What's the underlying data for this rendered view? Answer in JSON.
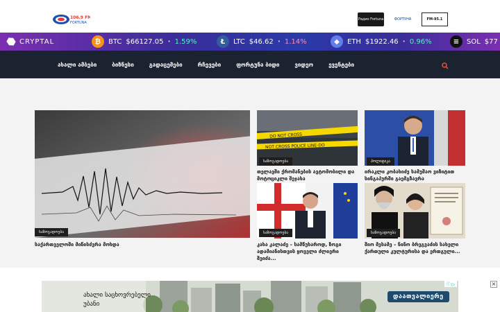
{
  "header": {
    "logo_text": "106.9 FM FORTUNA",
    "partners": [
      "Радио Fortuna",
      "ФОРТУНА",
      "FM-95.1"
    ]
  },
  "ticker": {
    "brand": "CRYPTAL",
    "coins": [
      {
        "symbol": "BTC",
        "price": "$66127.05",
        "change": "1.59%",
        "direction": "up",
        "icon": "bitcoin-icon",
        "color": "#f7931a"
      },
      {
        "symbol": "LTC",
        "price": "$46.62",
        "change": "1.14%",
        "direction": "down",
        "icon": "litecoin-icon",
        "color": "#345d9d"
      },
      {
        "symbol": "ETH",
        "price": "$1922.46",
        "change": "0.96%",
        "direction": "up",
        "icon": "ethereum-icon",
        "color": "#627eea"
      },
      {
        "symbol": "SOL",
        "price": "$77",
        "change": "",
        "direction": "up",
        "icon": "solana-icon",
        "color": "#111111"
      }
    ]
  },
  "nav": {
    "items": [
      "ახალი ამბები",
      "ბიზნესი",
      "გადაცემები",
      "რჩევები",
      "ფორტუნა ბიდი",
      "ვიდეო",
      "ევენტები"
    ],
    "search_icon": "search-icon",
    "accent": "#e74c3c"
  },
  "featured": {
    "category": "საზოგადოება",
    "title": "საქართველოში მიწისძვრა მოხდა"
  },
  "articles": [
    {
      "category": "საზოგადოება",
      "title": "თელავში ქრომანების ავტომობილი და მოტოციკლი შეჯახა"
    },
    {
      "category": "პოლიტიკა",
      "title": "ირაკლი კობახიძე სამუშაო ვიზიტით სინგაპურში გაემგზავრა"
    },
    {
      "category": "საზოგადოება",
      "title": "კახა კალაძე – სამწუხაროდ, ზოგი ადამიანისთვის ყოველი ძლიერი შეიძა..."
    },
    {
      "category": "საზოგადოება",
      "title": "შიო მესამე – ნინო ბრეგვაძის სახელი ქართული კულტურისა და ერთგული..."
    }
  ],
  "ad": {
    "text_line1": "ახალი საცხოვრებელი",
    "text_line2": "უბანი",
    "button": "დაათვალიერე",
    "close": "×",
    "info": "ⓘ ▷"
  }
}
